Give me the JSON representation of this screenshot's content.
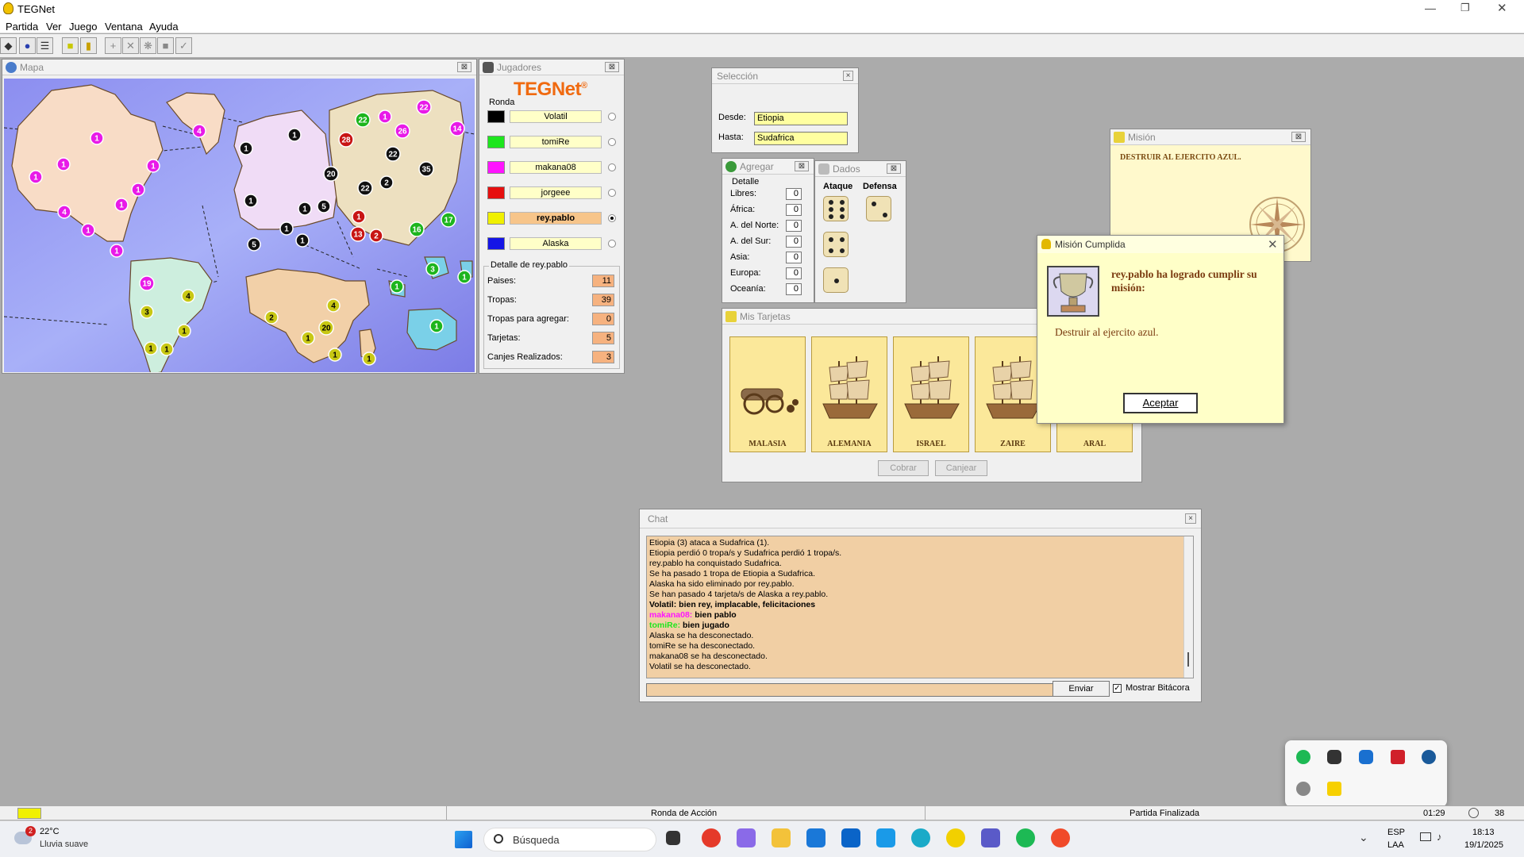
{
  "window": {
    "title": "TEGNet"
  },
  "menu": [
    "Partida",
    "Ver",
    "Juego",
    "Ventana",
    "Ayuda"
  ],
  "map_window": {
    "title": "Mapa",
    "armies": [
      {
        "n": "1",
        "c": "#e81ae8"
      },
      {
        "n": "4",
        "c": "#e81ae8"
      },
      {
        "n": "1",
        "c": "#e81ae8"
      },
      {
        "n": "1",
        "c": "#e81ae8"
      },
      {
        "n": "1",
        "c": "#e81ae8"
      },
      {
        "n": "1",
        "c": "#e81ae8"
      },
      {
        "n": "1",
        "c": "#e81ae8"
      },
      {
        "n": "4",
        "c": "#e81ae8"
      },
      {
        "n": "1",
        "c": "#e81ae8"
      },
      {
        "n": "1",
        "c": "#e81ae8"
      },
      {
        "n": "19",
        "c": "#e81ae8"
      },
      {
        "n": "3",
        "c": "#c8c814"
      },
      {
        "n": "4",
        "c": "#c8c814"
      },
      {
        "n": "1",
        "c": "#c8c814"
      },
      {
        "n": "1",
        "c": "#c8c814"
      },
      {
        "n": "1",
        "c": "#c8c814"
      },
      {
        "n": "2",
        "c": "#c8c814"
      },
      {
        "n": "4",
        "c": "#c8c814"
      },
      {
        "n": "20",
        "c": "#c8c814"
      },
      {
        "n": "1",
        "c": "#c8c814"
      },
      {
        "n": "1",
        "c": "#c8c814"
      },
      {
        "n": "1",
        "c": "#c8c814"
      },
      {
        "n": "1",
        "c": "#111"
      },
      {
        "n": "1",
        "c": "#111"
      },
      {
        "n": "20",
        "c": "#111"
      },
      {
        "n": "1",
        "c": "#111"
      },
      {
        "n": "1",
        "c": "#111"
      },
      {
        "n": "5",
        "c": "#111"
      },
      {
        "n": "1",
        "c": "#111"
      },
      {
        "n": "5",
        "c": "#111"
      },
      {
        "n": "1",
        "c": "#111"
      },
      {
        "n": "22",
        "c": "#111"
      },
      {
        "n": "2",
        "c": "#111"
      },
      {
        "n": "35",
        "c": "#111"
      },
      {
        "n": "22",
        "c": "#111"
      },
      {
        "n": "22",
        "c": "#1db51d"
      },
      {
        "n": "1",
        "c": "#e81ae8"
      },
      {
        "n": "28",
        "c": "#c81414"
      },
      {
        "n": "26",
        "c": "#e81ae8"
      },
      {
        "n": "22",
        "c": "#e81ae8"
      },
      {
        "n": "14",
        "c": "#e81ae8"
      },
      {
        "n": "1",
        "c": "#c81414"
      },
      {
        "n": "13",
        "c": "#c81414"
      },
      {
        "n": "2",
        "c": "#c81414"
      },
      {
        "n": "16",
        "c": "#1db51d"
      },
      {
        "n": "17",
        "c": "#1db51d"
      },
      {
        "n": "3",
        "c": "#1db51d"
      },
      {
        "n": "1",
        "c": "#1db51d"
      },
      {
        "n": "1",
        "c": "#1db51d"
      },
      {
        "n": "1",
        "c": "#1db51d"
      }
    ]
  },
  "players_window": {
    "title": "Jugadores",
    "logo": "TEGNet",
    "round_label": "Ronda",
    "players": [
      {
        "name": "Volatil",
        "color": "#000000",
        "active": false
      },
      {
        "name": "tomiRe",
        "color": "#1ee61e",
        "active": false
      },
      {
        "name": "makana08",
        "color": "#ff14ff",
        "active": false
      },
      {
        "name": "jorgeee",
        "color": "#e60f0f",
        "active": false
      },
      {
        "name": "rey.pablo",
        "color": "#f0f000",
        "active": true
      },
      {
        "name": "Alaska",
        "color": "#1414e6",
        "active": false
      }
    ],
    "detail_title": "Detalle de rey.pablo",
    "details": [
      {
        "label": "Paises:",
        "value": "11"
      },
      {
        "label": "Tropas:",
        "value": "39"
      },
      {
        "label": "Tropas para agregar:",
        "value": "0"
      },
      {
        "label": "Tarjetas:",
        "value": "5"
      },
      {
        "label": "Canjes Realizados:",
        "value": "3"
      }
    ]
  },
  "selection_window": {
    "title": "Selección",
    "from_label": "Desde:",
    "from_value": "Etiopia",
    "to_label": "Hasta:",
    "to_value": "Sudafrica"
  },
  "add_window": {
    "title": "Agregar",
    "detail": "Detalle",
    "rows": [
      {
        "label": "Libres:",
        "value": "0"
      },
      {
        "label": "África:",
        "value": "0"
      },
      {
        "label": "A. del Norte:",
        "value": "0"
      },
      {
        "label": "A. del Sur:",
        "value": "0"
      },
      {
        "label": "Asia:",
        "value": "0"
      },
      {
        "label": "Europa:",
        "value": "0"
      },
      {
        "label": "Oceanía:",
        "value": "0"
      }
    ]
  },
  "dice_window": {
    "title": "Dados",
    "attack_label": "Ataque",
    "defense_label": "Defensa",
    "attack": [
      6,
      4,
      1
    ],
    "defense": [
      2
    ]
  },
  "cards_window": {
    "title": "Mis Tarjetas",
    "cards": [
      {
        "name": "MALASIA",
        "kind": "cannon"
      },
      {
        "name": "ALEMANIA",
        "kind": "ship"
      },
      {
        "name": "ISRAEL",
        "kind": "ship"
      },
      {
        "name": "ZAIRE",
        "kind": "ship"
      },
      {
        "name": "ARAL",
        "kind": "ship"
      }
    ],
    "collect_button": "Cobrar",
    "exchange_button": "Canjear"
  },
  "mission_window": {
    "title": "Misión",
    "text": "DESTRUIR AL EJERCITO AZUL."
  },
  "mission_dialog": {
    "title": "Misión Cumplida",
    "heading": "rey.pablo ha logrado cumplir su misión:",
    "body": "Destruir al ejercito azul.",
    "accept": "Aceptar"
  },
  "chat_window": {
    "title": "Chat",
    "lines": [
      {
        "text": "Etiopia (3) ataca a Sudafrica (1).",
        "type": "log"
      },
      {
        "text": "Etiopia perdió 0 tropa/s y Sudafrica perdió 1 tropa/s.",
        "type": "log"
      },
      {
        "text": "rey.pablo ha conquistado Sudafrica.",
        "type": "log"
      },
      {
        "text": "Se ha pasado 1 tropa de Etiopia a Sudafrica.",
        "type": "log"
      },
      {
        "text": "Alaska ha sido eliminado por rey.pablo.",
        "type": "log"
      },
      {
        "text": "Se han pasado 4 tarjeta/s de Alaska a rey.pablo.",
        "type": "log"
      },
      {
        "user": "Volatil:",
        "msg": " bien rey, implacable, felicitaciones",
        "color": "#000000",
        "type": "chat"
      },
      {
        "user": "makana08:",
        "msg": " bien pablo",
        "color": "#ff14ff",
        "type": "chat"
      },
      {
        "user": "tomiRe:",
        "msg": " bien jugado",
        "color": "#1ee61e",
        "type": "chat"
      },
      {
        "text": "Alaska se ha desconectado.",
        "type": "log"
      },
      {
        "text": "tomiRe se ha desconectado.",
        "type": "log"
      },
      {
        "text": "makana08 se ha desconectado.",
        "type": "log"
      },
      {
        "text": "Volatil se ha desconectado.",
        "type": "log"
      }
    ],
    "send_button": "Enviar",
    "show_log_label": "Mostrar Bitácora",
    "input_value": ""
  },
  "statusbar": {
    "phase": "Ronda de Acción",
    "state": "Partida Finalizada",
    "time": "01:29",
    "count": "38"
  },
  "taskbar": {
    "weather_temp": "22°C",
    "weather_desc": "Lluvia suave",
    "weather_badge": "2",
    "search_placeholder": "Búsqueda",
    "lang1": "ESP",
    "lang2": "LAA",
    "clock_time": "18:13",
    "clock_date": "19/1/2025"
  }
}
